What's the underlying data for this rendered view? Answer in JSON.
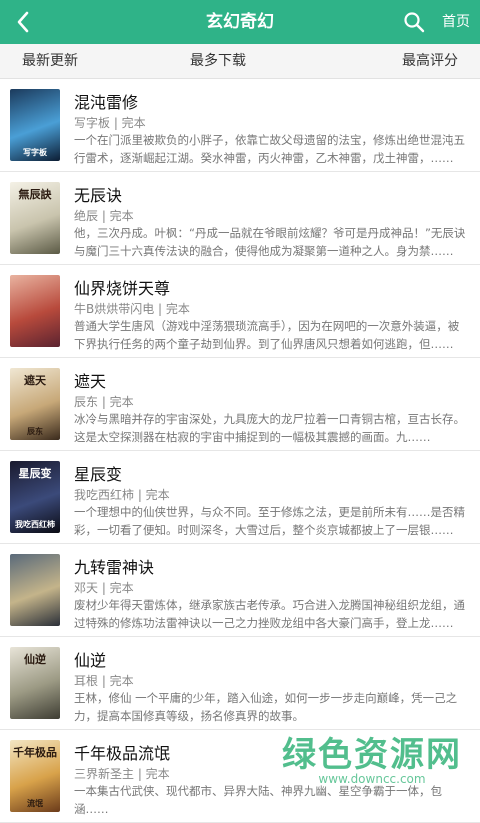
{
  "header": {
    "title": "玄幻奇幻",
    "home_label": "首页",
    "bg_color": "#2fb388"
  },
  "tabs": [
    {
      "label": "最新更新"
    },
    {
      "label": "最多下载"
    },
    {
      "label": "最高评分"
    }
  ],
  "books": [
    {
      "title": "混沌雷修",
      "meta": "写字板 | 完本",
      "desc": "一个在门派里被欺负的小胖子，依靠亡故父母遗留的法宝，修炼出绝世混沌五行雷术，逐渐崛起江湖。癸水神雷，丙火神雷，乙木神雷，戊土神雷，……",
      "cover_top": "",
      "cover_bottom": "写字板",
      "cover_colors": [
        "#1b3a5c",
        "#4a9fd6",
        "#0c1d33"
      ]
    },
    {
      "title": "无辰诀",
      "meta": "绝辰 | 完本",
      "desc": "他，三次丹成。叶枫：“丹成一品就在爷眼前炫耀？爷可是丹成神品！”无辰诀与魔门三十六真传法诀的融合，使得他成为凝聚第一道种之人。身为禁……",
      "cover_top": "無辰訣",
      "cover_bottom": "",
      "cover_colors": [
        "#f4f1e6",
        "#c9c4ad",
        "#5b5a45"
      ]
    },
    {
      "title": "仙界烧饼天尊",
      "meta": "牛B烘烘带闪电 | 完本",
      "desc": "普通大学生唐风（游戏中淫荡猥琐流高手），因为在网吧的一次意外装逼，被下界执行任务的两个童子劫到仙界。到了仙界唐风只想着如何逃跑，但……",
      "cover_top": "",
      "cover_bottom": "",
      "cover_colors": [
        "#e9b3a0",
        "#b84a3c",
        "#5b2330"
      ]
    },
    {
      "title": "遮天",
      "meta": "辰东 | 完本",
      "desc": "冰冷与黑暗并存的宇宙深处，九具庞大的龙尸拉着一口青铜古棺，亘古长存。这是太空探测器在枯寂的宇宙中捕捉到的一幅极其震撼的画面。九……",
      "cover_top": "遮天",
      "cover_bottom": "辰东",
      "cover_colors": [
        "#f0e7d3",
        "#c7a878",
        "#3a2a1c"
      ]
    },
    {
      "title": "星辰变",
      "meta": "我吃西红柿 | 完本",
      "desc": "一个理想中的仙侠世界，与众不同。至于修炼之法，更是前所未有……是否精彩，一切看了便知。时则深冬，大雪过后，整个炎京城都披上了一层银……",
      "cover_top": "星辰变",
      "cover_bottom": "我吃西红柿",
      "cover_colors": [
        "#1a1a2e",
        "#3b4a7a",
        "#0a0a12"
      ]
    },
    {
      "title": "九转雷神诀",
      "meta": "邓天 | 完本",
      "desc": "废材少年得天雷炼体，继承家族古老传承。巧合进入龙腾国神秘组织龙组，通过特殊的修炼功法雷神诀以一己之力挫败龙组中各大豪门高手，登上龙……",
      "cover_top": "",
      "cover_bottom": "",
      "cover_colors": [
        "#5a6a7a",
        "#c4b48a",
        "#2a2f38"
      ]
    },
    {
      "title": "仙逆",
      "meta": "耳根 | 完本",
      "desc": "王林，修仙 一个平庸的少年，踏入仙途，如何一步一步走向巅峰，凭一己之力，提高本国修真等级，扬名修真界的故事。",
      "cover_top": "仙逆",
      "cover_bottom": "",
      "cover_colors": [
        "#e8e4d8",
        "#9c9a84",
        "#3e3d33"
      ]
    },
    {
      "title": "千年极品流氓",
      "meta": "三界新圣主 | 完本",
      "desc": "一本集古代武侠、现代都市、异界大陆、神界九幽、星空争霸于一体，包涵……",
      "cover_top": "千年极品",
      "cover_bottom": "流氓",
      "cover_colors": [
        "#f3e6c4",
        "#d8a24a",
        "#6b3b1a"
      ]
    }
  ],
  "watermark": {
    "main": "绿色资源网",
    "url": "www.downcc.com"
  }
}
